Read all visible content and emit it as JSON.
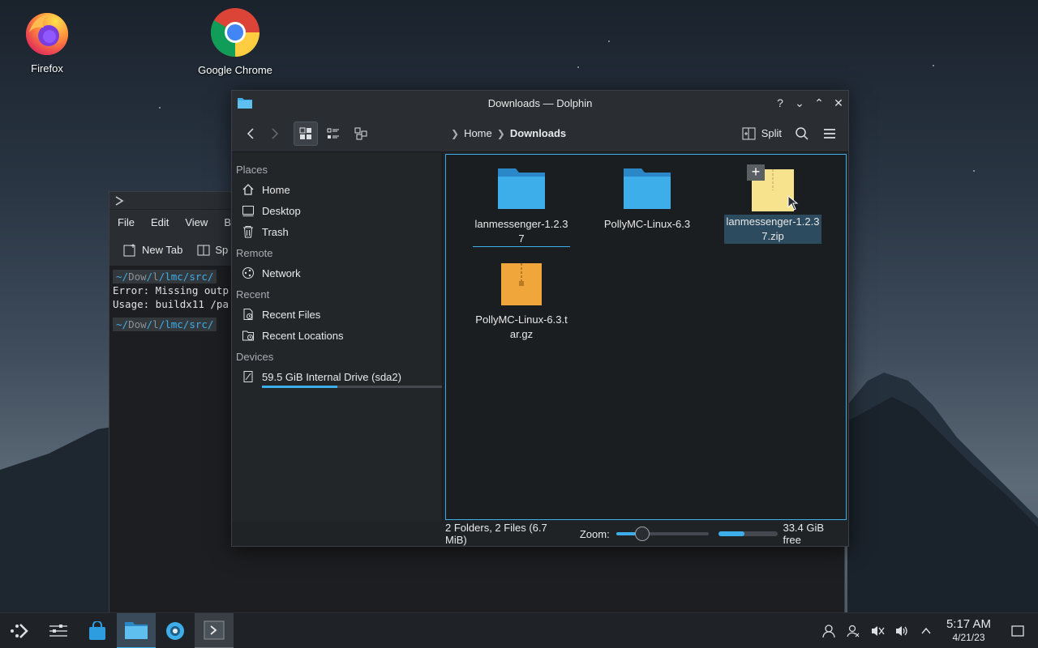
{
  "desktop": {
    "icons": [
      {
        "label": "Firefox",
        "icon": "firefox-icon"
      },
      {
        "label": "Google Chrome",
        "icon": "chrome-icon"
      }
    ]
  },
  "konsole": {
    "menu": [
      "File",
      "Edit",
      "View",
      "B"
    ],
    "toolbar": {
      "new_tab": "New Tab",
      "split": "Sp"
    },
    "prompt1": {
      "tilde": "~/",
      "path1": "Dow",
      "slash": "/",
      "path2": "l",
      "path3": "lmc/src/"
    },
    "line1": "Error: Missing outp",
    "line2": "Usage: buildx11 /pa",
    "prompt2": {
      "tilde": "~/",
      "path1": "Dow",
      "slash": "/",
      "path2": "l",
      "path3": "lmc/src/"
    }
  },
  "dolphin": {
    "title": "Downloads — Dolphin",
    "controls": {
      "help": "?",
      "minimize": "⌄",
      "maximize": "⌃",
      "close": "✕"
    },
    "breadcrumb": {
      "home": "Home",
      "current": "Downloads"
    },
    "split_label": "Split",
    "places": {
      "places_header": "Places",
      "home": "Home",
      "desktop": "Desktop",
      "trash": "Trash",
      "remote_header": "Remote",
      "network": "Network",
      "recent_header": "Recent",
      "recent_files": "Recent Files",
      "recent_locations": "Recent Locations",
      "devices_header": "Devices",
      "drive": "59.5 GiB Internal Drive (sda2)",
      "drive_used_fraction": 0.42
    },
    "files": [
      {
        "name": "lanmessenger-1.2.37",
        "type": "folder"
      },
      {
        "name": "PollyMC-Linux-6.3",
        "type": "folder"
      },
      {
        "name": "lanmessenger-1.2.37.zip",
        "type": "zip",
        "selected": true
      },
      {
        "name": "PollyMC-Linux-6.3.tar.gz",
        "type": "archive"
      }
    ],
    "status": {
      "summary": "2 Folders, 2 Files (6.7 MiB)",
      "zoom_label": "Zoom:",
      "zoom_fraction": 0.28,
      "free_fraction": 0.44,
      "free_label": "33.4 GiB free"
    }
  },
  "taskbar": {
    "time": "5:17 AM",
    "date": "4/21/23"
  },
  "colors": {
    "accent": "#3daee9",
    "folder": "#3daee9",
    "archive": "#f0a63a",
    "zip": "#f7e28e"
  }
}
